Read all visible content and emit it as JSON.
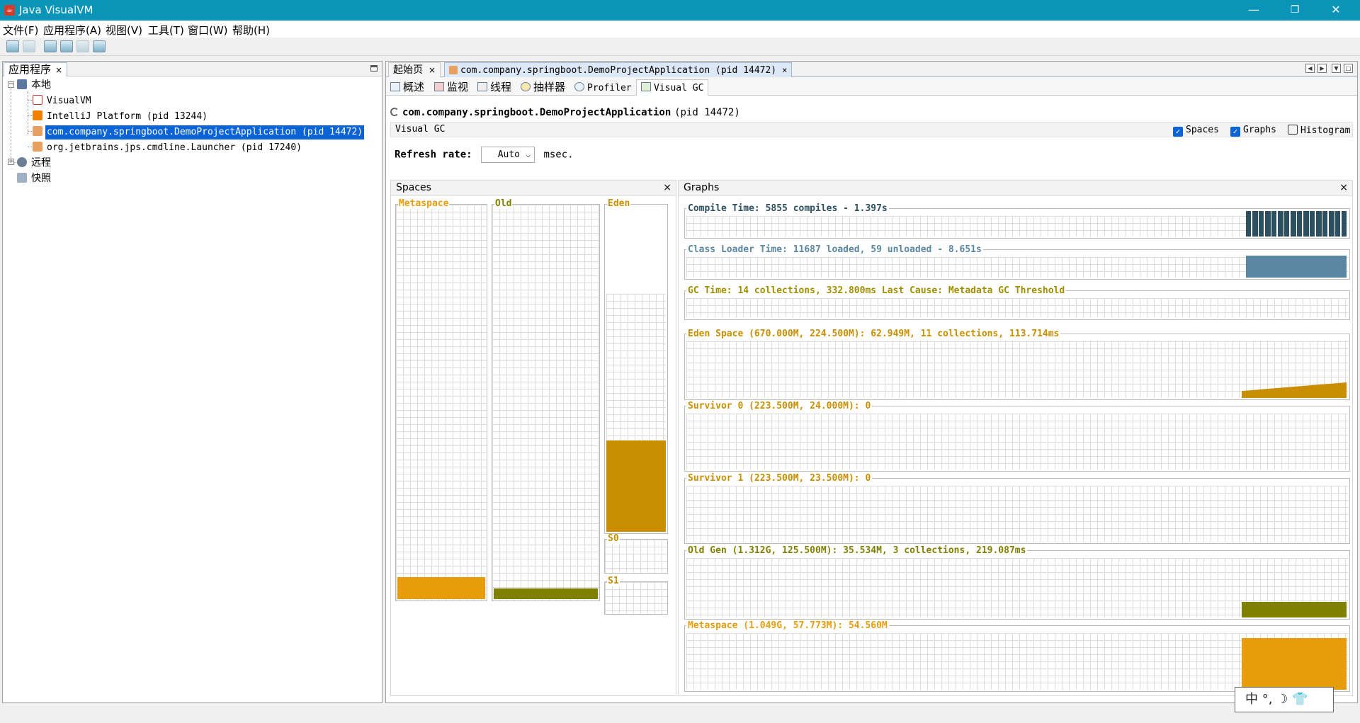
{
  "window": {
    "title": "Java VisualVM",
    "app_icon": "java-icon"
  },
  "window_buttons": {
    "minimize": "—",
    "maximize": "❐",
    "close": "✕"
  },
  "menu": [
    "文件(F)",
    "应用程序(A)",
    "视图(V)",
    "工具(T)",
    "窗口(W)",
    "帮助(H)"
  ],
  "toolbar": {
    "icons": [
      "load-app-icon",
      "save-snapshot-icon",
      "add-host-icon",
      "add-jmx-icon",
      "add-coredump-icon",
      "add-snapshot-icon"
    ]
  },
  "left_panel": {
    "tab": "应用程序",
    "tab_close": "×",
    "tree": {
      "local": "本地",
      "local_items": [
        "VisualVM",
        "IntelliJ Platform (pid 13244)",
        "com.company.springboot.DemoProjectApplication (pid 14472)",
        "org.jetbrains.jps.cmdline.Launcher (pid 17240)"
      ],
      "selected": "com.company.springboot.DemoProjectApplication (pid 14472)",
      "remote": "远程",
      "snapshots": "快照"
    }
  },
  "editor": {
    "tabs": [
      "起始页",
      "com.company.springboot.DemoProjectApplication (pid 14472)"
    ],
    "tab_close": "×",
    "active_tab": 1
  },
  "subtabs": {
    "overview": "概述",
    "monitor": "监视",
    "threads": "线程",
    "sampler": "抽样器",
    "profiler": "Profiler",
    "visualgc": "Visual GC",
    "active": "Visual GC"
  },
  "app_header": {
    "name": "com.company.springboot.DemoProjectApplication",
    "pid": "(pid 14472)"
  },
  "visual_gc": {
    "label": "Visual GC",
    "spaces_label": "Spaces",
    "spaces_checked": true,
    "graphs_label": "Graphs",
    "graphs_checked": true,
    "histogram_label": "Histogram",
    "histogram_checked": false,
    "refresh_label": "Refresh rate:",
    "refresh_value": "Auto",
    "refresh_unit": "msec.",
    "close": "×"
  },
  "spaces": {
    "title": "Spaces",
    "metaspace": {
      "label": "Metaspace",
      "fill": 0.055,
      "color": "#e79c0c"
    },
    "old": {
      "label": "Old",
      "fill": 0.027,
      "color": "#7f7f00"
    },
    "eden": {
      "label": "Eden",
      "fill": 0.28,
      "capacity": 0.73,
      "color": "#c98f00"
    },
    "s0": {
      "label": "S0",
      "fill": 0
    },
    "s1": {
      "label": "S1",
      "fill": 0
    }
  },
  "graphs": {
    "title": "Graphs",
    "compile": {
      "label": "Compile Time: 5855 compiles - 1.397s",
      "color": "#2d5061"
    },
    "classloader": {
      "label": "Class Loader Time: 11687 loaded, 59 unloaded - 8.651s",
      "color": "#5b86a2"
    },
    "gc": {
      "label": "GC Time: 14 collections, 332.800ms Last Cause: Metadata GC Threshold",
      "color": "#a08e00"
    },
    "eden": {
      "label": "Eden Space (670.000M, 224.500M): 62.949M, 11 collections, 113.714ms",
      "color": "#c98f00"
    },
    "s0": {
      "label": "Survivor 0 (223.500M, 24.000M): 0",
      "color": "#c98f00"
    },
    "s1": {
      "label": "Survivor 1 (223.500M, 23.500M): 0",
      "color": "#c98f00"
    },
    "oldgen": {
      "label": "Old Gen (1.312G, 125.500M): 35.534M, 3 collections, 219.087ms",
      "color": "#7f7f00"
    },
    "meta": {
      "label": "Metaspace (1.049G, 57.773M): 54.560M",
      "color": "#e79c0c"
    }
  },
  "ime": {
    "label": "中 °, ☽ 👕"
  }
}
